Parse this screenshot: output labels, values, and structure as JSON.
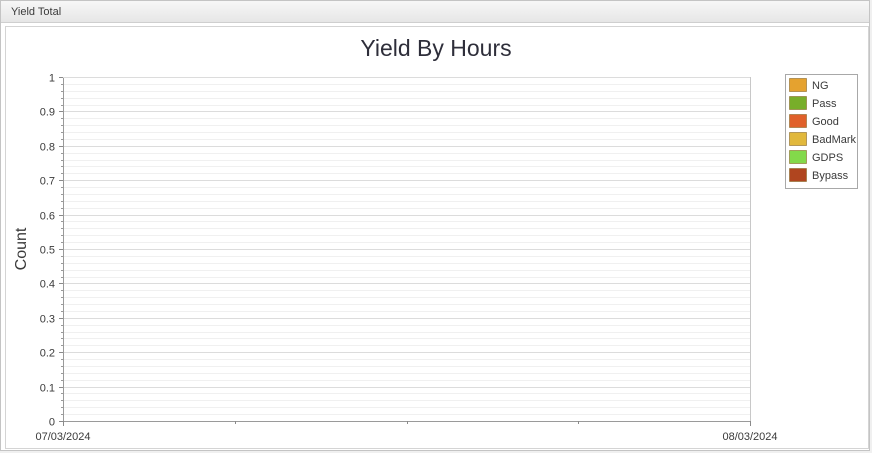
{
  "panel": {
    "title": "Yield Total"
  },
  "chart_data": {
    "type": "bar",
    "title": "Yield By Hours",
    "xlabel": "",
    "ylabel": "Count",
    "ylim": [
      0,
      1
    ],
    "yticks": [
      "0",
      "0.1",
      "0.2",
      "0.3",
      "0.4",
      "0.5",
      "0.6",
      "0.7",
      "0.8",
      "0.9",
      "1"
    ],
    "xticks": [
      "07/03/2024",
      "08/03/2024"
    ],
    "categories": [],
    "grid": true,
    "legend_position": "top-right",
    "series": [
      {
        "name": "NG",
        "color": "#e5a22f",
        "values": []
      },
      {
        "name": "Pass",
        "color": "#78ae2a",
        "values": []
      },
      {
        "name": "Good",
        "color": "#e0602a",
        "values": []
      },
      {
        "name": "BadMark",
        "color": "#e1b83c",
        "values": []
      },
      {
        "name": "GDPS",
        "color": "#83d94a",
        "values": []
      },
      {
        "name": "Bypass",
        "color": "#b0451f",
        "values": []
      }
    ]
  }
}
